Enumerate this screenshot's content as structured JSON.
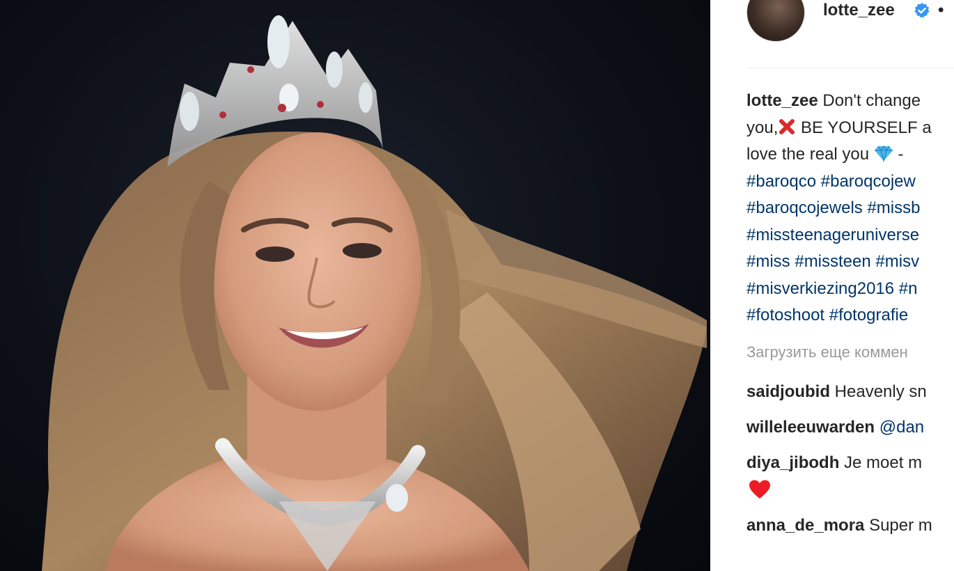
{
  "post": {
    "username": "lotte_zee",
    "separator": "•",
    "caption": {
      "author": "lotte_zee",
      "line1": "Don't change",
      "line2_prefix": "you,",
      "line2_text": "BE YOURSELF a",
      "line3_text": "love the real you",
      "line3_suffix": "-",
      "hashtag_lines": [
        "#baroqco #baroqcojew",
        "#baroqcojewels #missb",
        "#missteenageruniverse",
        "#miss #missteen #misv",
        "#misverkiezing2016 #n",
        "#fotoshoot #fotografie"
      ]
    },
    "load_more": "Загрузить еще коммен",
    "comments": [
      {
        "user": "saidjoubid",
        "text": "Heavenly sn"
      },
      {
        "user": "willeleeuwarden",
        "mention": "@dan"
      },
      {
        "user": "diya_jibodh",
        "text": "Je moet m"
      },
      {
        "user": "anna_de_mora",
        "text": "Super m"
      }
    ],
    "icons": {
      "verified": "verified-badge-icon",
      "cross": "red-cross-emoji",
      "gem": "gem-emoji",
      "heart": "red-heart-emoji"
    },
    "colors": {
      "hashtag": "#003569",
      "verified": "#3897f0",
      "muted": "#999999",
      "heart": "#ed1c24"
    }
  }
}
